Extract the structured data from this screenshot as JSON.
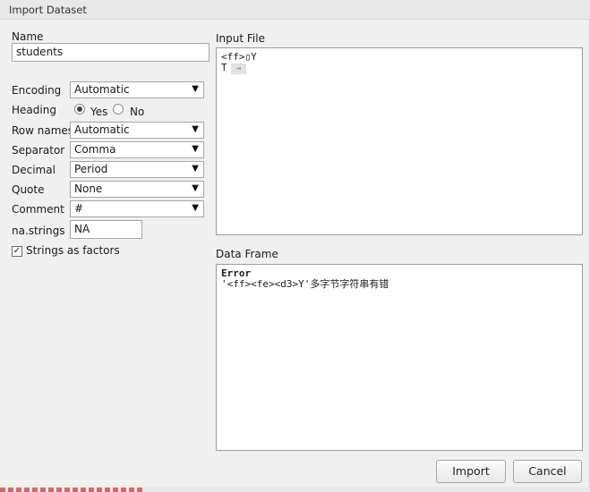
{
  "window": {
    "title": "Import Dataset"
  },
  "form": {
    "name_label": "Name",
    "name_value": "students",
    "encoding_label": "Encoding",
    "encoding_value": "Automatic",
    "heading_label": "Heading",
    "heading_yes": "Yes",
    "heading_no": "No",
    "heading_selected": "Yes",
    "rownames_label": "Row names",
    "rownames_value": "Automatic",
    "separator_label": "Separator",
    "separator_value": "Comma",
    "decimal_label": "Decimal",
    "decimal_value": "Period",
    "quote_label": "Quote",
    "quote_value": "None",
    "comment_label": "Comment",
    "comment_value": "#",
    "nastrings_label": "na.strings",
    "nastrings_value": "NA",
    "strings_factors_label": "Strings as factors",
    "strings_factors_checked": true
  },
  "input_file": {
    "label": "Input File",
    "line1": "<ff>▯Y",
    "line2": "T",
    "line2_tab": "⇥"
  },
  "data_frame": {
    "label": "Data Frame",
    "error_title": "Error",
    "error_message": "'<ff><fe><d3>Y'多字节字符串有错"
  },
  "buttons": {
    "import": "Import",
    "cancel": "Cancel"
  }
}
